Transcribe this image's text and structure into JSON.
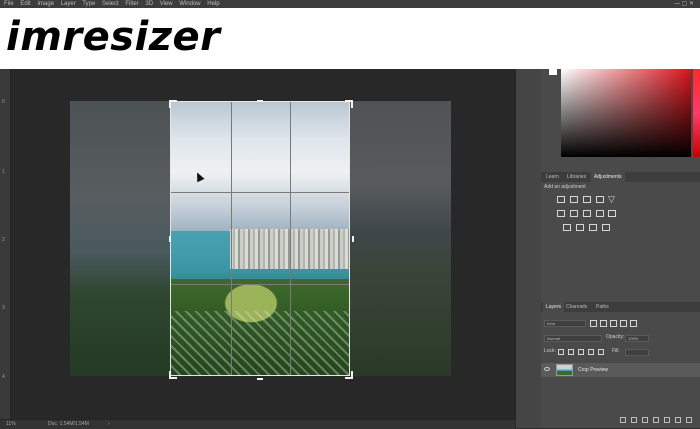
{
  "brand": {
    "text": "imresizer"
  },
  "menu": {
    "items": [
      "File",
      "Edit",
      "Image",
      "Layer",
      "Type",
      "Select",
      "Filter",
      "3D",
      "View",
      "Window",
      "Help"
    ],
    "window_controls": "—  ▢  ✕"
  },
  "ruler": {
    "labels": [
      "0",
      "1",
      "2",
      "3",
      "4"
    ]
  },
  "status": {
    "zoom": "11%",
    "doc": "Doc: 1.54M/1.54M",
    "arrow": "›"
  },
  "adjustments_panel": {
    "tabs": [
      "Learn",
      "Libraries",
      "Adjustments"
    ],
    "active_tab": "Adjustments",
    "hint": "Add an adjustment"
  },
  "layers_panel": {
    "tabs": [
      "Layers",
      "Channels",
      "Paths"
    ],
    "active_tab": "Layers",
    "filter_placeholder": "Kind",
    "blend_mode": "Normal",
    "opacity_label": "Opacity:",
    "opacity_value": "100%",
    "lock_label": "Lock:",
    "fill_label": "Fill:",
    "layer_name": "Crop Preview"
  },
  "colors": {
    "accent": "#d8141c",
    "panel": "#4a4a4a",
    "canvas": "#282828"
  },
  "icons": [
    "cursor-arrow-icon",
    "eye-icon",
    "link-icon",
    "fx-icon",
    "mask-icon",
    "adjustment-icon",
    "folder-icon",
    "new-layer-icon",
    "trash-icon"
  ]
}
